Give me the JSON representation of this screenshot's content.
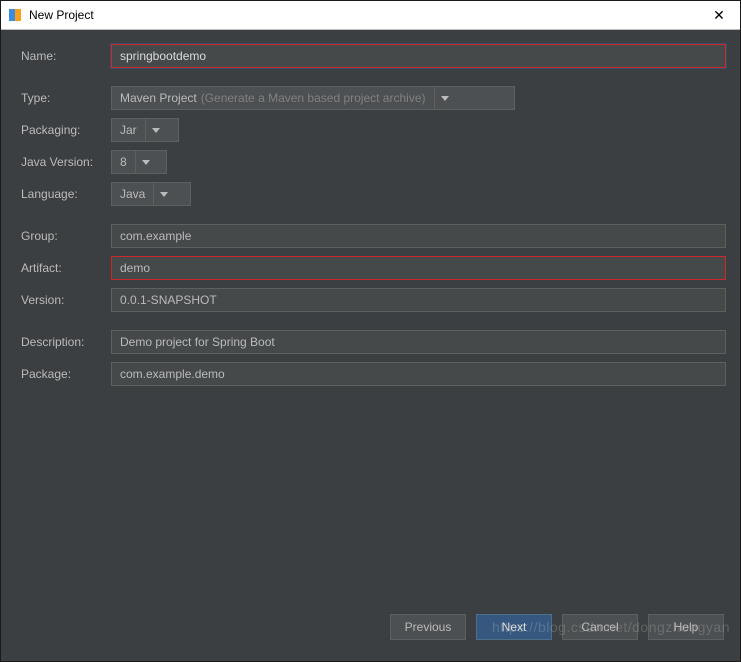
{
  "window": {
    "title": "New Project",
    "close_symbol": "✕"
  },
  "form": {
    "name": {
      "label": "Name:",
      "value": "springbootdemo"
    },
    "type": {
      "label": "Type:",
      "value": "Maven Project",
      "hint": "(Generate a Maven based project archive)"
    },
    "packaging": {
      "label": "Packaging:",
      "value": "Jar"
    },
    "javaVersion": {
      "label": "Java Version:",
      "value": "8"
    },
    "language": {
      "label": "Language:",
      "value": "Java"
    },
    "group": {
      "label": "Group:",
      "value": "com.example"
    },
    "artifact": {
      "label": "Artifact:",
      "value": "demo"
    },
    "version": {
      "label": "Version:",
      "value": "0.0.1-SNAPSHOT"
    },
    "description": {
      "label": "Description:",
      "value": "Demo project for Spring Boot"
    },
    "pkg": {
      "label": "Package:",
      "value": "com.example.demo"
    }
  },
  "buttons": {
    "previous": "Previous",
    "next": "Next",
    "cancel": "Cancel",
    "help": "Help"
  },
  "watermark": "https://blog.csdn.net/dongzhongyan"
}
